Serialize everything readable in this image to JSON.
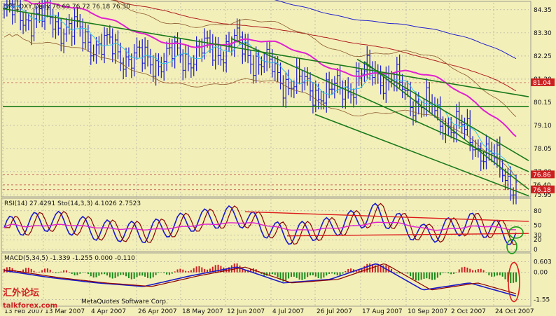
{
  "colors": {
    "background": "#f3efb9",
    "price_up": "#1a1acc",
    "price_down": "#1a1acc",
    "ma_fast": "#33c3e6",
    "ma_mid": "#e020d0",
    "ma_long_red": "#b02020",
    "ma_long_blue": "#2020cc",
    "bollinger": "#8b5a2b",
    "trendline": "#1a7a1a",
    "grid": "#a0a0a0",
    "red_price_box": "#cc2020",
    "rsi": "#1a1acc",
    "stoch_main": "#8b0000",
    "stoch_signal": "#e020d0",
    "macd_pos": "#cc2020",
    "macd_neg": "#1a8a1a",
    "annotation_green": "#1a9a1a",
    "annotation_red": "#dd1a1a"
  },
  "price_panel": {
    "header": "SPT_DXY,Daily  76.69 76.72 76.18 76.30",
    "price_labels": [
      "84.35",
      "83.30",
      "82.25",
      "81.20",
      "80.15",
      "79.10",
      "78.05",
      "77.00",
      "75.95"
    ],
    "boxed_labels": {
      "upper": "81.04",
      "mid": "76.86",
      "current": "76.40",
      "low": "76.18"
    }
  },
  "rsi_panel": {
    "header": "RSI(14) 27.4291  Sto(14,3,3) 4.1026 2.7523",
    "levels": [
      "80",
      "50",
      "30",
      "20",
      "0"
    ]
  },
  "macd_panel": {
    "header": "MACD(5,34,5) -1.339 -1.255 0.000 -0.110",
    "levels": [
      "0.603",
      "0.00",
      "-1.55"
    ]
  },
  "date_labels": [
    "13 Feb 2007",
    "13 Mar 2007",
    "4 Apr 2007",
    "26 Apr 2007",
    "18 May 2007",
    "12 Jun 2007",
    "4 Jul 2007",
    "26 Jul 2007",
    "17 Aug 2007",
    "10 Sep 2007",
    "2 Oct 2007",
    "24 Oct 2007"
  ],
  "watermark": {
    "main": "汇外论坛",
    "site": "talkforex.com",
    "copyright": "MetaQuotes Software Corp."
  },
  "chart_data": {
    "type": "line",
    "title": "SPT_DXY,Daily",
    "ohlc_last": {
      "open": 76.69,
      "high": 76.72,
      "low": 76.18,
      "close": 76.3
    },
    "x": [
      "13 Feb 2007",
      "13 Mar 2007",
      "4 Apr 2007",
      "26 Apr 2007",
      "18 May 2007",
      "12 Jun 2007",
      "4 Jul 2007",
      "26 Jul 2007",
      "17 Aug 2007",
      "10 Sep 2007",
      "2 Oct 2007",
      "24 Oct 2007"
    ],
    "ylim": [
      75.95,
      84.6
    ],
    "series": [
      {
        "name": "SPT_DXY",
        "values": [
          84.2,
          83.9,
          82.8,
          82.0,
          82.3,
          82.8,
          81.2,
          80.5,
          81.6,
          80.0,
          78.6,
          76.4
        ]
      }
    ],
    "rsi": {
      "value": 27.4291,
      "values": [
        45,
        60,
        40,
        35,
        58,
        70,
        30,
        45,
        75,
        30,
        55,
        27
      ]
    },
    "stochastic": {
      "main": 4.1026,
      "signal": 2.7523
    },
    "macd": {
      "main": -1.339,
      "signal": -1.255,
      "histogram": [
        0.2,
        0.1,
        -0.2,
        -0.3,
        0.2,
        0.4,
        -0.4,
        -0.2,
        0.5,
        -0.5,
        0.3,
        -0.6
      ],
      "line": [
        0.1,
        -0.3,
        -0.6,
        -0.8,
        -0.2,
        0.3,
        -0.6,
        -0.4,
        0.5,
        -1.0,
        -0.6,
        -1.34
      ]
    },
    "ylabel": "",
    "xlabel": ""
  }
}
